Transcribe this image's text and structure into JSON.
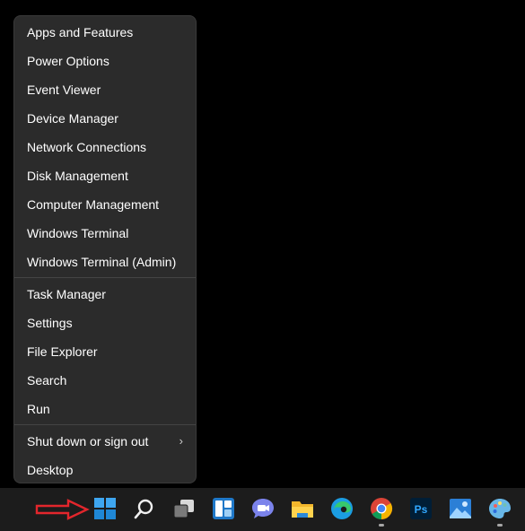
{
  "menu": {
    "group1": [
      {
        "label": "Apps and Features"
      },
      {
        "label": "Power Options"
      },
      {
        "label": "Event Viewer"
      },
      {
        "label": "Device Manager"
      },
      {
        "label": "Network Connections"
      },
      {
        "label": "Disk Management"
      },
      {
        "label": "Computer Management"
      },
      {
        "label": "Windows Terminal"
      },
      {
        "label": "Windows Terminal (Admin)"
      }
    ],
    "group2": [
      {
        "label": "Task Manager"
      },
      {
        "label": "Settings"
      },
      {
        "label": "File Explorer"
      },
      {
        "label": "Search"
      },
      {
        "label": "Run"
      }
    ],
    "group3": [
      {
        "label": "Shut down or sign out",
        "chevron": "›"
      },
      {
        "label": "Desktop"
      }
    ]
  },
  "taskbar": {
    "icons": [
      {
        "name": "start-icon"
      },
      {
        "name": "search-icon"
      },
      {
        "name": "task-view-icon"
      },
      {
        "name": "widgets-icon"
      },
      {
        "name": "teams-chat-icon"
      },
      {
        "name": "file-explorer-icon"
      },
      {
        "name": "edge-icon"
      },
      {
        "name": "chrome-icon",
        "running": true
      },
      {
        "name": "photoshop-icon",
        "text": "Ps"
      },
      {
        "name": "photos-icon"
      },
      {
        "name": "paint-icon",
        "running": true
      }
    ]
  },
  "colors": {
    "menu_bg": "#2b2b2b",
    "taskbar_bg": "#1c1c1c",
    "accent": "#0078d4",
    "arrow": "#e3262c"
  }
}
